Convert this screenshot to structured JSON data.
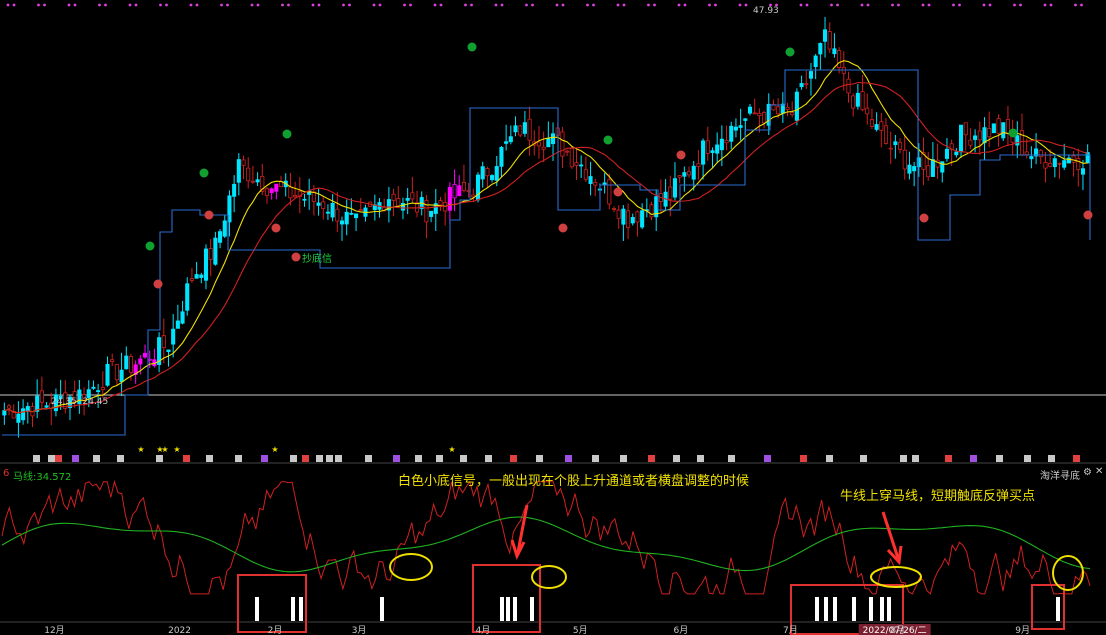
{
  "colors": {
    "bg": "#000000",
    "up": "#00e5ff",
    "down": "#d02020",
    "accent_magenta": "#ff00ff",
    "ma_yellow": "#f0e000",
    "ma_red": "#d02020",
    "stair_blue": "#2a6cd0",
    "osc_red": "#d02020",
    "osc_green": "#20b020",
    "signal_white": "#ffffff",
    "box_red": "#e03030",
    "circle_yellow": "#f0e000",
    "annot_text": "#f0e000"
  },
  "header": {
    "peak_label": "47.93",
    "low_labels": "24.35  24.45",
    "mid_label": "抄底信"
  },
  "sub_panel": {
    "index_label": "6",
    "ma_label": "马线:34.572",
    "right_label": "淘洋寻底"
  },
  "annotations": {
    "text1": "白色小底信号，一般出现在个股上升通道或者横盘调整的时候",
    "text2": "牛线上穿马线，短期触底反弹买点"
  },
  "x_axis": {
    "ticks": [
      {
        "label": "12月",
        "pos": 0.04
      },
      {
        "label": "2022",
        "pos": 0.152
      },
      {
        "label": "2月",
        "pos": 0.242
      },
      {
        "label": "3月",
        "pos": 0.318
      },
      {
        "label": "4月",
        "pos": 0.43
      },
      {
        "label": "5月",
        "pos": 0.518
      },
      {
        "label": "6月",
        "pos": 0.609
      },
      {
        "label": "7月",
        "pos": 0.708
      },
      {
        "label": "2022/07/26/二",
        "pos": 0.78
      },
      {
        "label": "8月",
        "pos": 0.805
      },
      {
        "label": "9月",
        "pos": 0.918
      }
    ]
  },
  "chart_data": [
    {
      "type": "candlestick",
      "ylim": [
        20,
        49
      ],
      "n": 200,
      "close_trend": [
        [
          0,
          22.0
        ],
        [
          10,
          22.5
        ],
        [
          18,
          23.3
        ],
        [
          22,
          24.4
        ],
        [
          28,
          25.2
        ],
        [
          35,
          26.5
        ],
        [
          40,
          31.0
        ],
        [
          45,
          33.0
        ],
        [
          50,
          38.5
        ],
        [
          56,
          37.2
        ],
        [
          62,
          36.5
        ],
        [
          68,
          36.0
        ],
        [
          75,
          34.5
        ],
        [
          82,
          36.5
        ],
        [
          90,
          35.5
        ],
        [
          100,
          37.0
        ],
        [
          110,
          41.0
        ],
        [
          118,
          40.0
        ],
        [
          125,
          38.0
        ],
        [
          133,
          35.0
        ],
        [
          142,
          36.5
        ],
        [
          150,
          40.0
        ],
        [
          160,
          42.0
        ],
        [
          168,
          42.0
        ],
        [
          175,
          47.0
        ],
        [
          180,
          43.5
        ],
        [
          188,
          40.0
        ],
        [
          196,
          38.0
        ],
        [
          204,
          40.5
        ],
        [
          212,
          41.0
        ],
        [
          220,
          39.0
        ],
        [
          228,
          39.0
        ]
      ],
      "price_marks": {
        "peak": 47.93,
        "low_a": 24.35,
        "low_b": 24.45
      }
    },
    {
      "type": "line",
      "series": [
        {
          "name": "马线",
          "color": "#20b020",
          "last": 34.572
        }
      ],
      "signals_index": [
        57,
        66,
        68,
        86,
        113,
        116,
        118,
        120,
        184,
        186,
        188,
        190,
        192,
        196,
        199,
        238
      ]
    }
  ]
}
